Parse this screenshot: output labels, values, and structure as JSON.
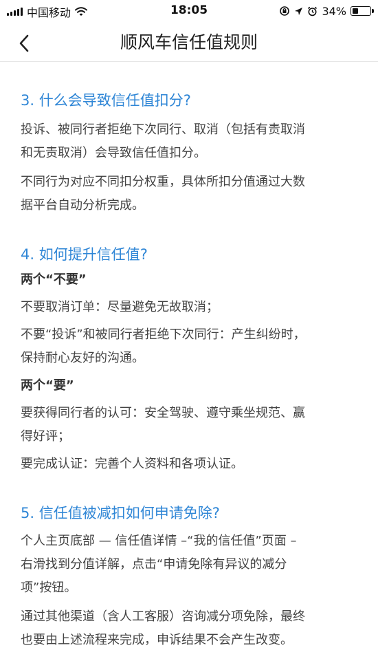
{
  "status_bar": {
    "carrier": "中国移动",
    "time": "18:05",
    "battery": "34%",
    "battery_level": 0.34
  },
  "header": {
    "title": "顺风车信任值规则"
  },
  "sections": [
    {
      "title": "3. 什么会导致信任值扣分?",
      "paragraphs": [
        [
          "投诉、被同行者拒绝下次同行、取消（包括有责取消",
          "和无责取消）会导致信任值扣分。"
        ],
        [
          "不同行为对应不同扣分权重，具体所扣分值通过大数",
          "据平台自动分析完成。"
        ]
      ]
    },
    {
      "title": "4. 如何提升信任值?",
      "sub1": "两个“不要”",
      "p1": "不要取消订单：尽量避免无故取消；",
      "p2": [
        "不要“投诉”和被同行者拒绝下次同行：产生纠纷时，",
        "保持耐心友好的沟通。"
      ],
      "sub2": "两个“要”",
      "p3": [
        "要获得同行者的认可：安全驾驶、遵守乘坐规范、赢",
        "得好评；"
      ],
      "p4": "要完成认证：完善个人资料和各项认证。"
    },
    {
      "title": "5. 信任值被减扣如何申请免除?",
      "paragraphs": [
        [
          "个人主页底部 — 信任值详情 –“我的信任值”页面 –",
          "右滑找到分值详解，点击“申请免除有异议的减分",
          "项”按钮。"
        ],
        [
          "通过其他渠道（含人工客服）咨询减分项免除，最终",
          "也要由上述流程来完成，申诉结果不会产生改变。"
        ]
      ]
    }
  ]
}
